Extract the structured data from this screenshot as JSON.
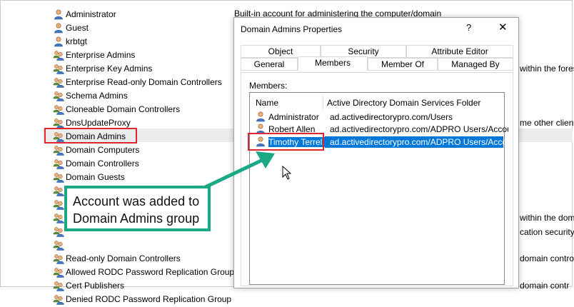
{
  "groups": [
    {
      "label": "Administrator",
      "icon": "user-icon"
    },
    {
      "label": "Guest",
      "icon": "user-icon"
    },
    {
      "label": "krbtgt",
      "icon": "user-icon"
    },
    {
      "label": "Enterprise Admins",
      "icon": "group-icon"
    },
    {
      "label": "Enterprise Key Admins",
      "icon": "group-icon"
    },
    {
      "label": "Enterprise Read-only Domain Controllers",
      "icon": "group-icon"
    },
    {
      "label": "Schema Admins",
      "icon": "group-icon"
    },
    {
      "label": "Cloneable Domain Controllers",
      "icon": "group-icon"
    },
    {
      "label": "DnsUpdateProxy",
      "icon": "group-icon"
    },
    {
      "label": "Domain Admins",
      "icon": "group-icon"
    },
    {
      "label": "Domain Computers",
      "icon": "group-icon"
    },
    {
      "label": "Domain Controllers",
      "icon": "group-icon"
    },
    {
      "label": "Domain Guests",
      "icon": "group-icon"
    },
    {
      "label": "",
      "icon": "group-icon"
    },
    {
      "label": "",
      "icon": "group-icon"
    },
    {
      "label": "",
      "icon": "group-icon"
    },
    {
      "label": "",
      "icon": "group-icon"
    },
    {
      "label": "",
      "icon": "group-icon"
    },
    {
      "label": "Read-only Domain Controllers",
      "icon": "group-icon"
    },
    {
      "label": "Allowed RODC Password Replication Group",
      "icon": "group-icon"
    },
    {
      "label": "Cert Publishers",
      "icon": "group-icon"
    },
    {
      "label": "Denied RODC Password Replication Group",
      "icon": "group-icon"
    }
  ],
  "description_first": "Built-in account for administering the computer/domain",
  "right_fragments": [
    "within the forest",
    "me other client",
    "within the domain",
    "cation security",
    "domain controll",
    "domain contr"
  ],
  "dialog": {
    "title": "Domain Admins Properties",
    "help": "?",
    "close": "✕",
    "tabs_row1": [
      "Object",
      "Security",
      "Attribute Editor"
    ],
    "tabs_row2": [
      "General",
      "Members",
      "Member Of",
      "Managed By"
    ],
    "members_label": "Members:",
    "columns": [
      "Name",
      "Active Directory Domain Services Folder"
    ],
    "members": [
      {
        "name": "Administrator",
        "folder": "ad.activedirectorypro.com/Users"
      },
      {
        "name": "Robert Allen",
        "folder": "ad.activedirectorypro.com/ADPRO Users/Accou..."
      },
      {
        "name": "Timothy Terrell",
        "folder": "ad.activedirectorypro.com/ADPRO Users/Accou..."
      }
    ]
  },
  "callout": "Account was added to Domain Admins group",
  "colors": {
    "highlight_red": "#e0262e",
    "callout_green": "#1ba886",
    "selection_blue": "#0078d7"
  }
}
